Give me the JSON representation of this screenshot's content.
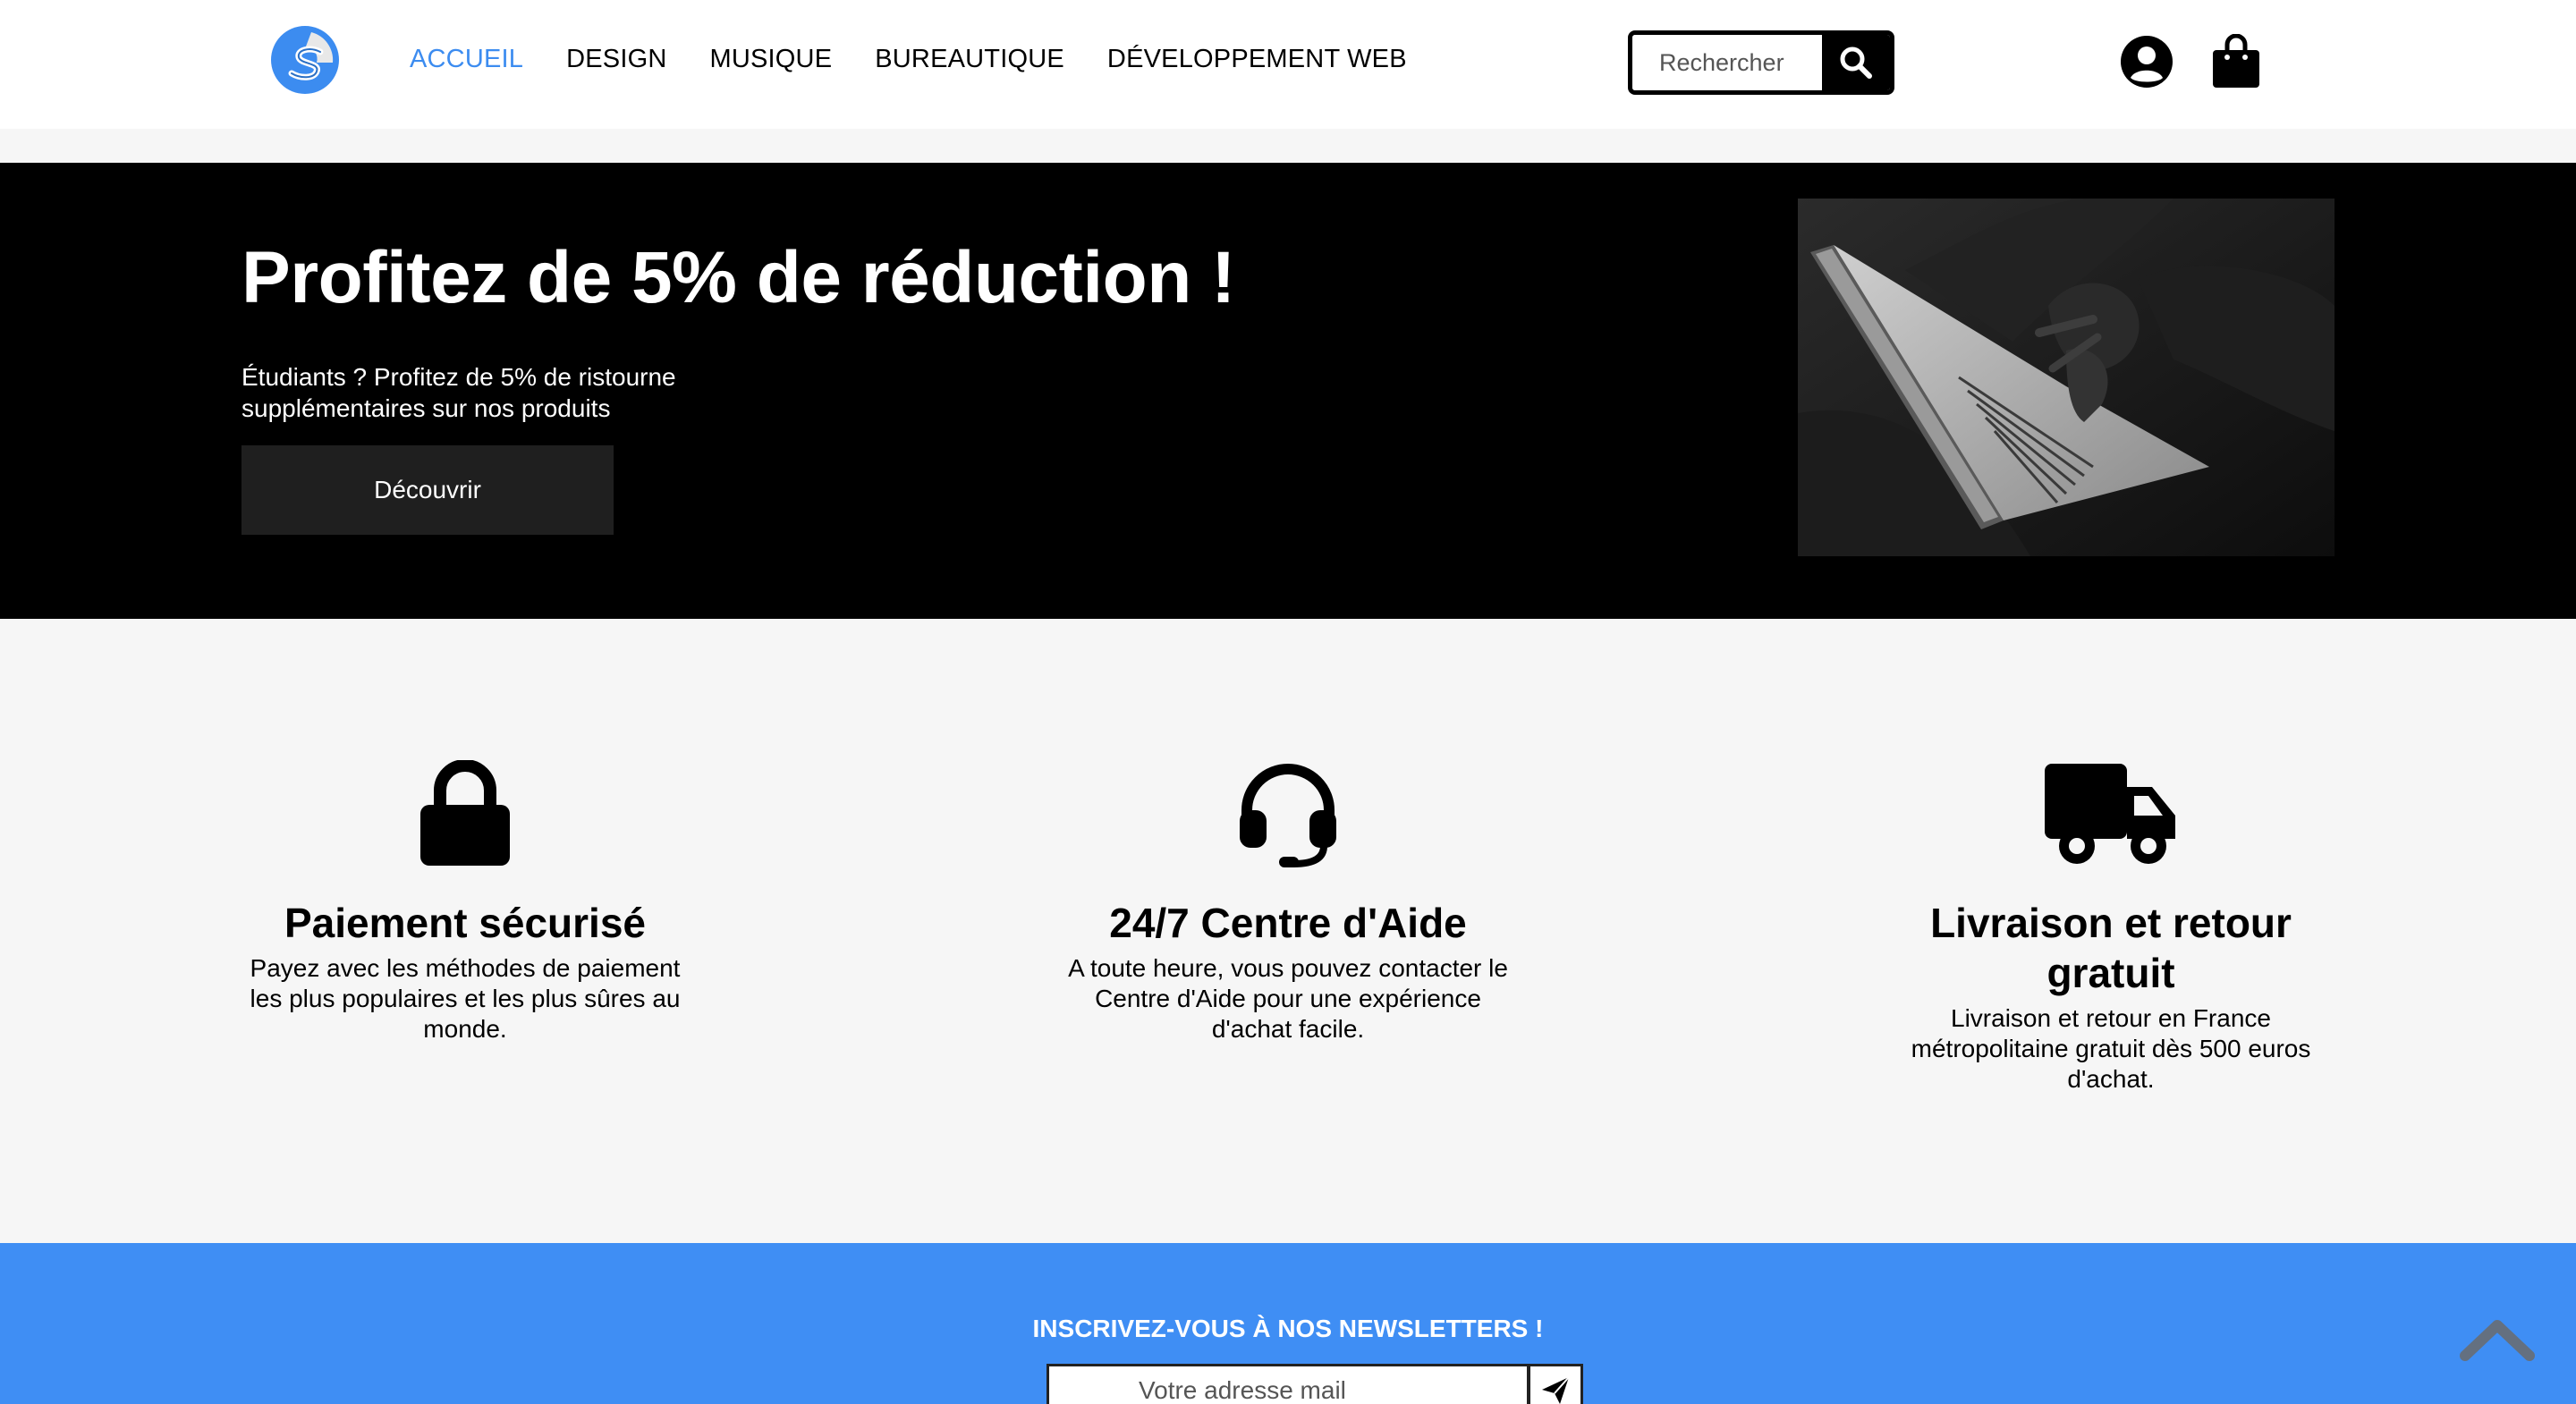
{
  "header": {
    "logo": {
      "name": "site-logo",
      "letter": "S",
      "colors": [
        "#3c8cf0",
        "#e6e6e6"
      ]
    },
    "nav": [
      {
        "label": "ACCUEIL",
        "active": true
      },
      {
        "label": "DESIGN",
        "active": false
      },
      {
        "label": "MUSIQUE",
        "active": false
      },
      {
        "label": "BUREAUTIQUE",
        "active": false
      },
      {
        "label": "DÉVELOPPEMENT WEB",
        "active": false
      }
    ],
    "search": {
      "placeholder": "Rechercher",
      "icon": "search-icon"
    },
    "account_icon": "user-circle-icon",
    "cart_icon": "shopping-bag-icon"
  },
  "hero": {
    "title": "Profitez de 5% de réduction !",
    "text": "Étudiants ? Profitez de 5% de ristourne supplémentaires sur nos produits",
    "button_label": "Découvrir",
    "image": "laptop-photo"
  },
  "features": [
    {
      "icon": "lock-icon",
      "title": "Paiement sécurisé",
      "text": "Payez avec les méthodes de paiement les plus populaires et les plus sûres au monde."
    },
    {
      "icon": "headset-icon",
      "title": "24/7 Centre d'Aide",
      "text": "A toute heure, vous pouvez contacter le Centre d'Aide pour une expérience d'achat facile."
    },
    {
      "icon": "truck-icon",
      "title": "Livraison et retour gratuit",
      "text": "Livraison et retour en France métropolitaine gratuit dès 500 euros d'achat."
    }
  ],
  "newsletter": {
    "title": "INSCRIVEZ-VOUS À NOS NEWSLETTERS !",
    "placeholder": "Votre adresse mail",
    "submit_icon": "send-icon"
  },
  "scroll_top_icon": "chevron-up-icon",
  "colors": {
    "accent": "#3c8cf0",
    "newsletter_bg": "#3f8ef4",
    "hero_bg": "#000000",
    "page_bg": "#f6f6f6"
  }
}
